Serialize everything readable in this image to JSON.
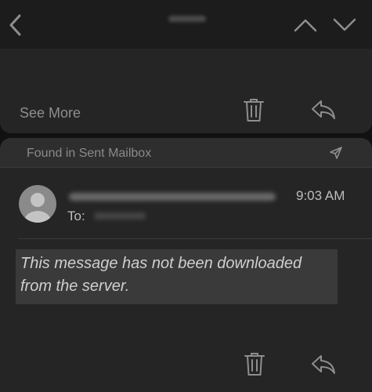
{
  "colors": {
    "background": "#111111",
    "card": "#252525",
    "header": "#2e2e2e",
    "icon": "#8e8e8e",
    "text_secondary": "#8a8a8a",
    "text_primary": "#cfcfcf"
  },
  "navbar": {
    "back_icon": "chevron-left-icon",
    "prev_icon": "chevron-up-icon",
    "next_icon": "chevron-down-icon"
  },
  "previous_message": {
    "see_more_label": "See More",
    "trash_icon": "trash-icon",
    "reply_icon": "reply-icon"
  },
  "message": {
    "mailbox_label": "Found in Sent Mailbox",
    "mailbox_icon": "paper-plane-icon",
    "to_label": "To:",
    "time": "9:03 AM",
    "body": "This message has not been downloaded from the server.",
    "trash_icon": "trash-icon",
    "reply_icon": "reply-icon"
  }
}
